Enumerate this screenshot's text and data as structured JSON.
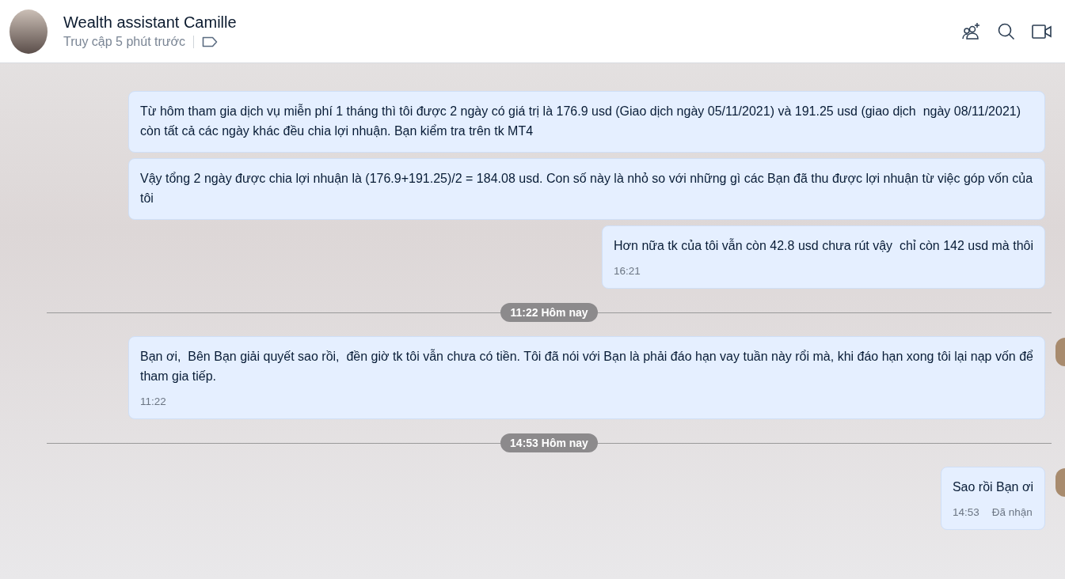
{
  "header": {
    "name": "Wealth assistant Camille",
    "status": "Truy cập 5 phút trước"
  },
  "messages": [
    {
      "kind": "message",
      "text": "Từ hôm tham gia dịch vụ miễn phí 1 tháng thì tôi được 2 ngày có giá trị là 176.9 usd (Giao dịch ngày 05/11/2021) và 191.25 usd (giao dịch  ngày 08/11/2021) còn tất cả các ngày khác đều chia lợi nhuận. Bạn kiểm tra trên tk MT4",
      "avatar": false
    },
    {
      "kind": "message",
      "text": "Vậy tổng 2 ngày được chia lợi nhuận là (176.9+191.25)/2 = 184.08 usd. Con số này là nhỏ so với những gì các Bạn đã thu được lợi nhuận từ việc góp vốn của tôi",
      "avatar": false
    },
    {
      "kind": "message",
      "text": "Hơn nữa tk của tôi vẫn còn 42.8 usd chưa rút vậy  chỉ còn 142 usd mà thôi",
      "time": "16:21",
      "avatar": false
    },
    {
      "kind": "divider",
      "label": "11:22 Hôm nay"
    },
    {
      "kind": "message",
      "text": "Bạn ơi,  Bên Bạn giải quyết sao rồi,  đền giờ tk tôi vẫn chưa có tiền. Tôi đã nói với Bạn là phải đáo hạn vay tuần này rổi mà, khi đáo hạn xong tôi lại nạp vốn để tham gia tiếp.",
      "time": "11:22",
      "avatar": true
    },
    {
      "kind": "divider",
      "label": "14:53 Hôm nay"
    },
    {
      "kind": "message",
      "text": "Sao rồi Bạn ơi",
      "time": "14:53",
      "status": "Đã nhận",
      "avatar": true
    }
  ]
}
